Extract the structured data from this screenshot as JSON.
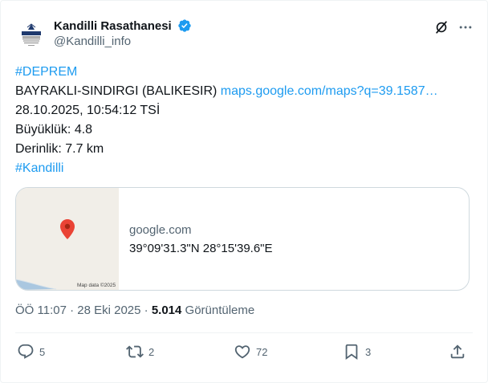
{
  "author": {
    "display_name": "Kandilli Rasathanesi",
    "handle": "@Kandilli_info",
    "avatar_text": "KANDILLI"
  },
  "tweet": {
    "hashtag1": "#DEPREM",
    "location": "BAYRAKLI-SINDIRGI (BALIKESIR) ",
    "location_link": "maps.google.com/maps?q=39.1587…",
    "datetime": "28.10.2025, 10:54:12 TSİ",
    "magnitude": "Büyüklük: 4.8",
    "depth": "Derinlik: 7.7 km",
    "hashtag2": "#Kandilli"
  },
  "card": {
    "domain": "google.com",
    "title": "39°09'31.3\"N 28°15'39.6\"E",
    "map_credit": "Map data ©2025"
  },
  "meta": {
    "time": "ÖÖ 11:07 · 28 Eki 2025 · ",
    "views_count": "5.014",
    "views_label": " Görüntüleme"
  },
  "actions": {
    "replies": "5",
    "reposts": "2",
    "likes": "72",
    "bookmarks": "3"
  },
  "colors": {
    "link": "#1d9bf0",
    "verified": "#1d9bf0",
    "muted": "#536471",
    "pin": "#ea4335"
  },
  "icons": {
    "verified": "verified-badge-icon",
    "grok": "grok-icon",
    "more": "more-icon",
    "reply": "reply-icon",
    "repost": "repost-icon",
    "like": "heart-icon",
    "bookmark": "bookmark-icon",
    "share": "share-icon"
  }
}
